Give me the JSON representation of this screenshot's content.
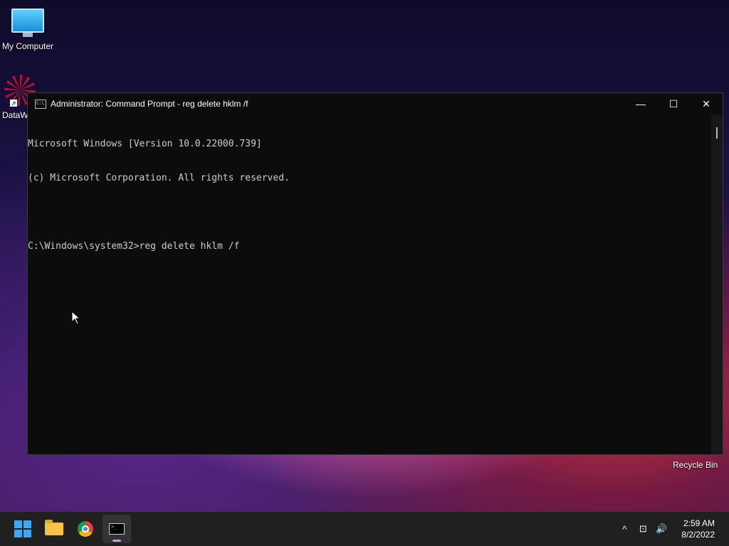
{
  "desktop": {
    "icons": [
      {
        "label": "My Computer",
        "icon": "computer-icon"
      },
      {
        "label": "DataW",
        "icon": "datawatch-icon"
      }
    ],
    "recycle_bin_label": "Recycle Bin"
  },
  "window": {
    "title": "Administrator: Command Prompt - reg  delete hklm /f",
    "controls": {
      "minimize": "—",
      "maximize": "☐",
      "close": "✕"
    },
    "lines": [
      "Microsoft Windows [Version 10.0.22000.739]",
      "(c) Microsoft Corporation. All rights reserved.",
      "",
      "C:\\Windows\\system32>reg delete hklm /f"
    ]
  },
  "taskbar": {
    "apps": [
      "start-icon",
      "file-explorer-icon",
      "chrome-icon",
      "command-prompt-icon"
    ],
    "active_app": "command-prompt-icon",
    "tray": {
      "chevron": "^",
      "network": "⊡",
      "volume": "🔊"
    },
    "time": "2:59 AM",
    "date": "8/2/2022"
  }
}
